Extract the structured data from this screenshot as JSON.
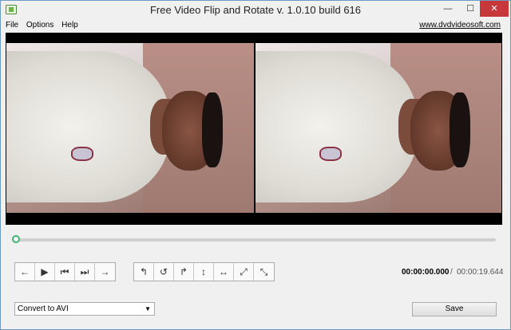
{
  "window": {
    "title": "Free Video Flip and Rotate v. 1.0.10 build 616",
    "min_glyph": "—",
    "max_glyph": "☐",
    "close_glyph": "✕"
  },
  "menu": {
    "items": [
      "File",
      "Options",
      "Help"
    ],
    "site_link": "www.dvdvideosoft.com"
  },
  "playback": {
    "progress": 0.0,
    "buttons": [
      "step-back",
      "play",
      "to-start",
      "to-end",
      "step-forward"
    ]
  },
  "rotate_buttons": [
    "rotate-left",
    "rotate-ccw",
    "rotate-right",
    "flip-vertical",
    "flip-horizontal",
    "transpose",
    "transverse"
  ],
  "time": {
    "current": "00:00:00.000",
    "separator": "/",
    "total": "00:00:19.644"
  },
  "convert": {
    "selected": "Convert to AVI"
  },
  "save_label": "Save"
}
